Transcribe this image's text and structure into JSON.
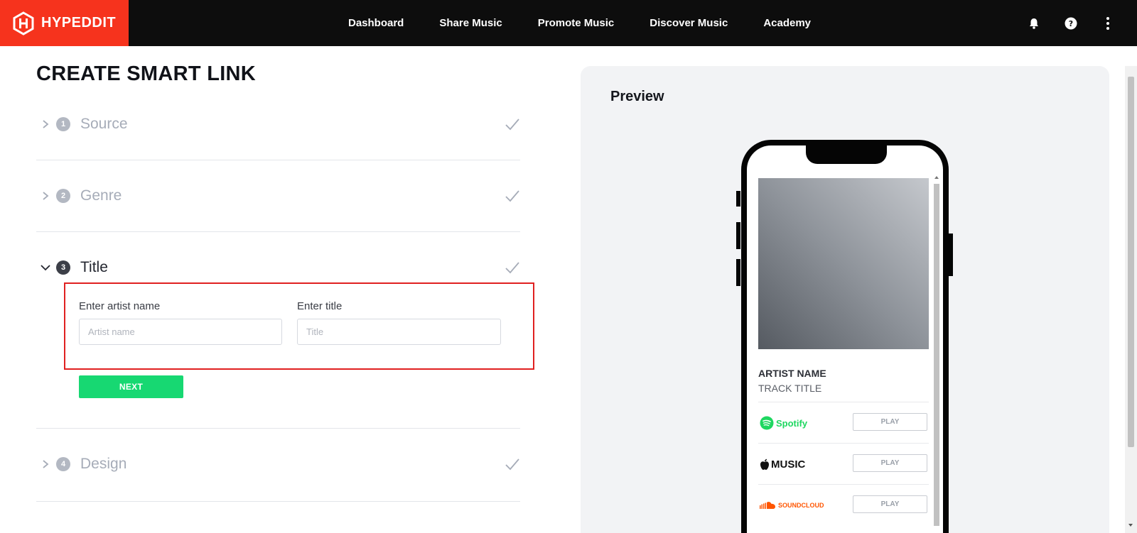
{
  "brand": {
    "name": "HYPEDDIT",
    "color": "#f6331d"
  },
  "nav": {
    "items": [
      "Dashboard",
      "Share Music",
      "Promote Music",
      "Discover Music",
      "Academy"
    ],
    "icons": [
      "bell-icon",
      "help-icon",
      "more-vertical-icon"
    ]
  },
  "page": {
    "title": "CREATE SMART LINK"
  },
  "steps": [
    {
      "number": "1",
      "label": "Source",
      "state": "completed"
    },
    {
      "number": "2",
      "label": "Genre",
      "state": "completed"
    },
    {
      "number": "3",
      "label": "Title",
      "state": "expanded"
    },
    {
      "number": "4",
      "label": "Design",
      "state": "completed"
    }
  ],
  "title_form": {
    "artist_label": "Enter artist name",
    "artist_placeholder": "Artist name",
    "artist_value": "",
    "title_label": "Enter title",
    "title_placeholder": "Title",
    "title_value": "",
    "next_label": "NEXT"
  },
  "preview": {
    "heading": "Preview",
    "artist": "ARTIST NAME",
    "track": "TRACK TITLE",
    "services": [
      {
        "name": "Spotify",
        "logo": "spotify-logo",
        "color": "#1ed760",
        "action": "PLAY"
      },
      {
        "name": "MUSIC",
        "logo": "apple-music-logo",
        "color": "#111111",
        "action": "PLAY"
      },
      {
        "name": "SOUNDCLOUD",
        "logo": "soundcloud-logo",
        "color": "#ff5500",
        "action": "PLAY"
      }
    ]
  },
  "colors": {
    "accent_green": "#17d872",
    "highlight_red": "#e02020",
    "nav_bg": "#0d0d0d"
  }
}
